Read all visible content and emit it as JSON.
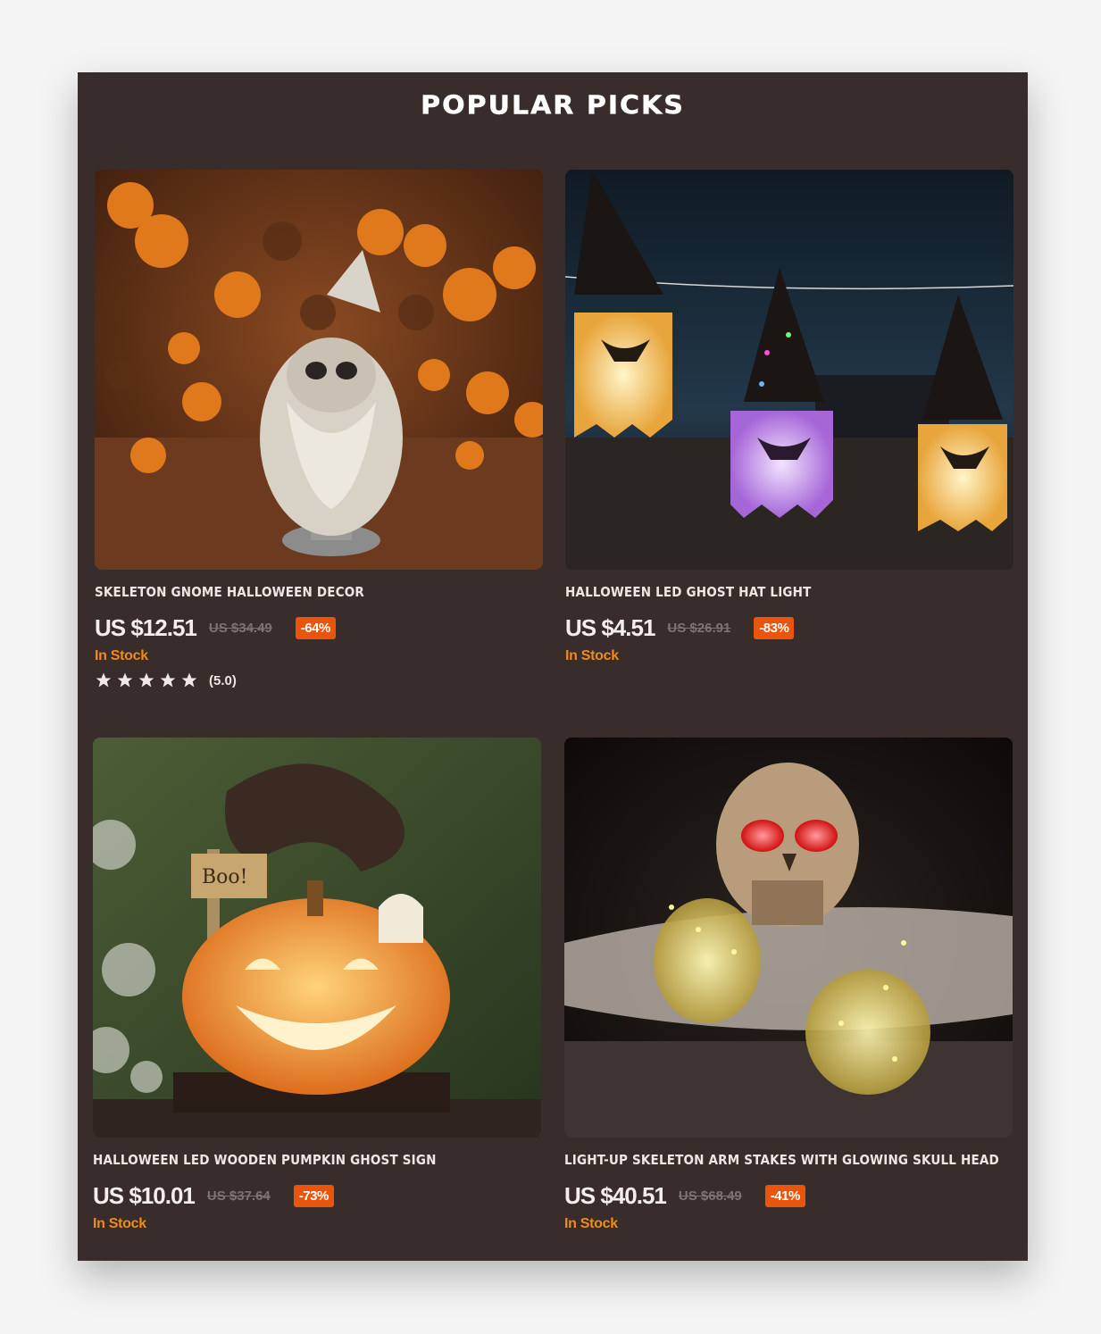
{
  "section": {
    "title": "POPULAR PICKS"
  },
  "products": [
    {
      "title": "Skeleton Gnome Halloween Decor",
      "image": "skeleton-gnome-image",
      "price": "US $12.51",
      "old_price": "US $34.49",
      "discount": "-64%",
      "stock": "In Stock",
      "rating": 5,
      "rating_text": "(5.0)"
    },
    {
      "title": "Halloween LED Ghost Hat Light",
      "image": "ghost-hat-light-image",
      "price": "US $4.51",
      "old_price": "US $26.91",
      "discount": "-83%",
      "stock": "In Stock"
    },
    {
      "title": "Halloween LED Wooden Pumpkin Ghost Sign",
      "image": "pumpkin-sign-image",
      "price": "US $10.01",
      "old_price": "US $37.64",
      "discount": "-73%",
      "stock": "In Stock"
    },
    {
      "title": "Light-Up Skeleton Arm Stakes with Glowing Skull Head",
      "image": "skeleton-arms-image",
      "price": "US $40.51",
      "old_price": "US $68.49",
      "discount": "-41%",
      "stock": "In Stock"
    }
  ],
  "colors": {
    "panel_bg": "#382d2b",
    "badge": "#e8550b",
    "stock": "#f08a1c"
  }
}
